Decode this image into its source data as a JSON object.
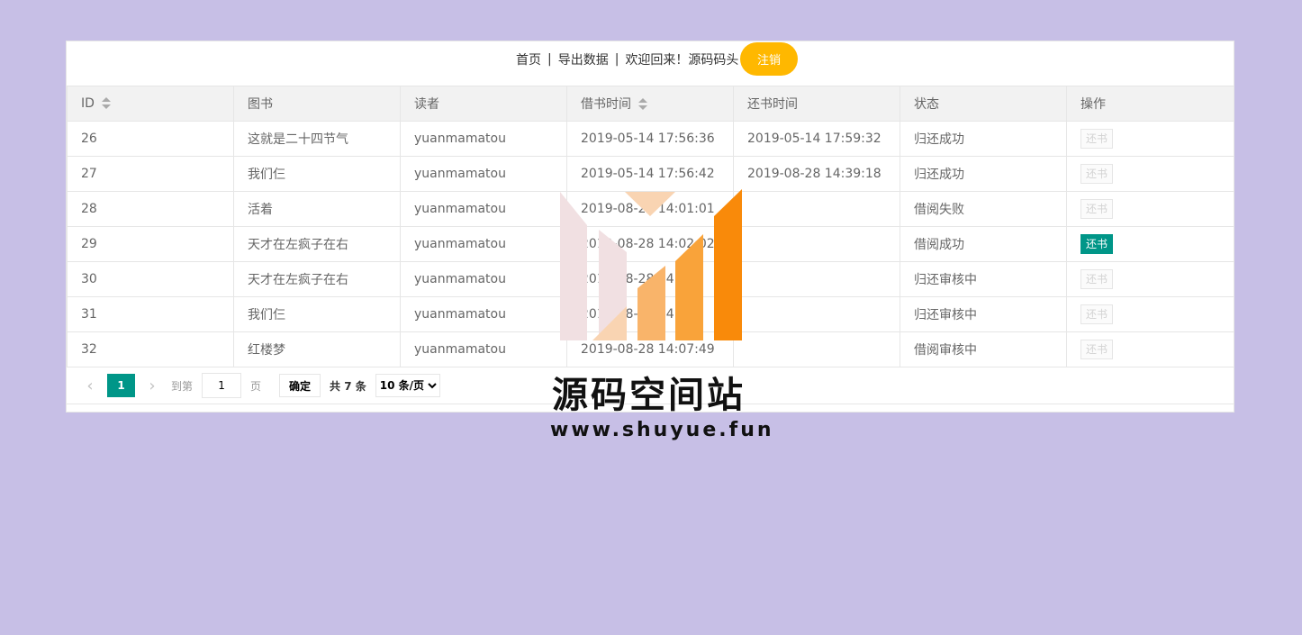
{
  "header": {
    "home": "首页",
    "export": "导出数据",
    "welcome": "欢迎回来！源码码头",
    "logout": "注销",
    "separator": "|"
  },
  "table": {
    "columns": [
      "ID",
      "图书",
      "读者",
      "借书时间",
      "还书时间",
      "状态",
      "操作"
    ],
    "rows": [
      {
        "id": "26",
        "book": "这就是二十四节气",
        "reader": "yuanmamatou",
        "borrow_time": "2019-05-14 17:56:36",
        "return_time": "2019-05-14 17:59:32",
        "status": "归还成功",
        "action": "还书",
        "action_active": false
      },
      {
        "id": "27",
        "book": "我们仨",
        "reader": "yuanmamatou",
        "borrow_time": "2019-05-14 17:56:42",
        "return_time": "2019-08-28 14:39:18",
        "status": "归还成功",
        "action": "还书",
        "action_active": false
      },
      {
        "id": "28",
        "book": "活着",
        "reader": "yuanmamatou",
        "borrow_time": "2019-08-28 14:01:01",
        "return_time": "",
        "status": "借阅失败",
        "action": "还书",
        "action_active": false
      },
      {
        "id": "29",
        "book": "天才在左疯子在右",
        "reader": "yuanmamatou",
        "borrow_time": "2019-08-28 14:02:02",
        "return_time": "",
        "status": "借阅成功",
        "action": "还书",
        "action_active": true
      },
      {
        "id": "30",
        "book": "天才在左疯子在右",
        "reader": "yuanmamatou",
        "borrow_time": "2019-08-28 14:03",
        "return_time": "",
        "status": "归还审核中",
        "action": "还书",
        "action_active": false
      },
      {
        "id": "31",
        "book": "我们仨",
        "reader": "yuanmamatou",
        "borrow_time": "2019-08-28 14:03",
        "return_time": "",
        "status": "归还审核中",
        "action": "还书",
        "action_active": false
      },
      {
        "id": "32",
        "book": "红楼梦",
        "reader": "yuanmamatou",
        "borrow_time": "2019-08-28 14:07:49",
        "return_time": "",
        "status": "借阅审核中",
        "action": "还书",
        "action_active": false
      }
    ]
  },
  "pager": {
    "prev": "‹",
    "current": "1",
    "next": "›",
    "goto_label": "到第",
    "goto_value": "1",
    "page_unit": "页",
    "confirm": "确定",
    "total": "共 7 条",
    "per_page": "10 条/页"
  },
  "watermark": {
    "title": "源码空间站",
    "url": "www.shuyue.fun"
  },
  "colors": {
    "background": "#c7bfe6",
    "logout": "#ffb800",
    "primary": "#009688"
  }
}
